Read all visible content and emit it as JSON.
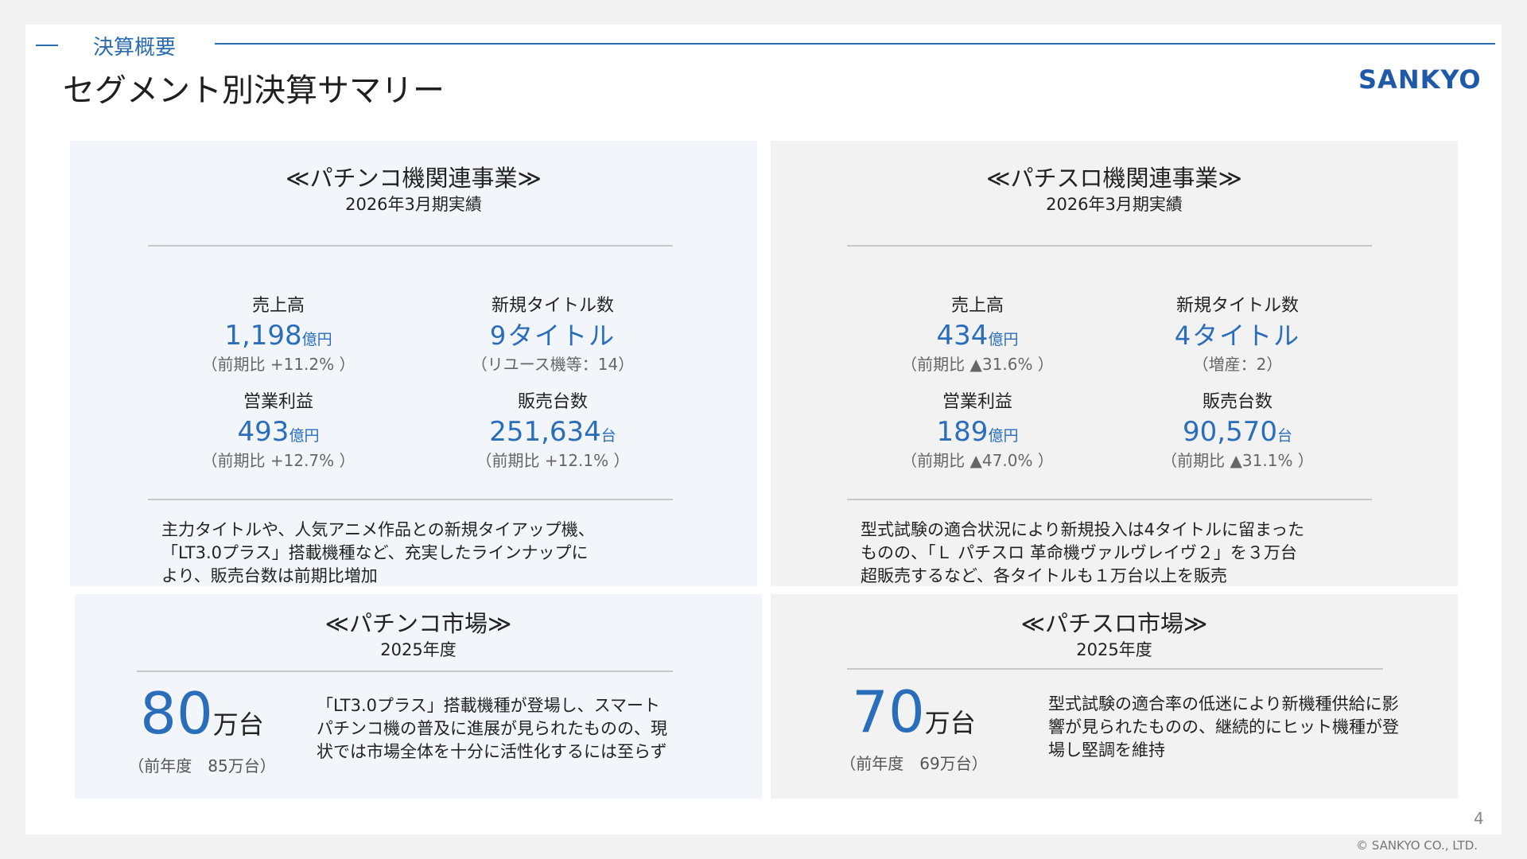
{
  "header": {
    "section_label": "決算概要",
    "title": "セグメント別決算サマリー",
    "logo_text": "SANKYO"
  },
  "pachinko_business": {
    "title": "≪パチンコ機関連事業≫",
    "period": "2026年3月期実績",
    "metrics": [
      {
        "label": "売上高",
        "value": "1,198",
        "unit": "億円",
        "note": "（前期比 +11.2% ）"
      },
      {
        "label": "新規タイトル数",
        "value": "9タイトル",
        "unit": "",
        "note": "（リユース機等：14）"
      },
      {
        "label": "営業利益",
        "value": "493",
        "unit": "億円",
        "note": "（前期比 +12.7% ）"
      },
      {
        "label": "販売台数",
        "value": "251,634",
        "unit": "台",
        "note": "（前期比 +12.1% ）"
      }
    ],
    "description": [
      "主力タイトルや、人気アニメ作品との新規タイアップ機、",
      "「LT3.0プラス」搭載機種など、充実したラインナップに",
      "より、販売台数は前期比増加"
    ]
  },
  "pachislot_business": {
    "title": "≪パチスロ機関連事業≫",
    "period": "2026年3月期実績",
    "metrics": [
      {
        "label": "売上高",
        "value": "434",
        "unit": "億円",
        "note": "（前期比 ▲31.6% ）"
      },
      {
        "label": "新規タイトル数",
        "value": "4タイトル",
        "unit": "",
        "note": "（増産：2）"
      },
      {
        "label": "営業利益",
        "value": "189",
        "unit": "億円",
        "note": "（前期比 ▲47.0% ）"
      },
      {
        "label": "販売台数",
        "value": "90,570",
        "unit": "台",
        "note": "（前期比 ▲31.1% ）"
      }
    ],
    "description": [
      "型式試験の適合状況により新規投入は4タイトルに留まった",
      "ものの、「Ｌ パチスロ 革命機ヴァルヴレイヴ２」を３万台",
      "超販売するなど、各タイトルも１万台以上を販売"
    ]
  },
  "pachinko_market": {
    "title": "≪パチンコ市場≫",
    "period": "2025年度",
    "value": "80",
    "unit": "万台",
    "previous": "（前年度　85万台）",
    "description": [
      "「LT3.0プラス」搭載機種が登場し、スマート",
      "パチンコ機の普及に進展が見られたものの、現",
      "状では市場全体を十分に活性化するには至らず"
    ]
  },
  "pachislot_market": {
    "title": "≪パチスロ市場≫",
    "period": "2025年度",
    "value": "70",
    "unit": "万台",
    "previous": "（前年度　69万台）",
    "description": [
      "型式試験の適合率の低迷により新機種供給に影",
      "響が見られたものの、継続的にヒット機種が登",
      "場し堅調を維持"
    ]
  },
  "footer": {
    "page_number": "4",
    "copyright": "© SANKYO CO., LTD."
  },
  "colors": {
    "accent": "#2a6ebb",
    "logo": "#1f5aa8",
    "panel_blue": "#f2f6fa",
    "panel_gray": "#f2f2f2"
  }
}
